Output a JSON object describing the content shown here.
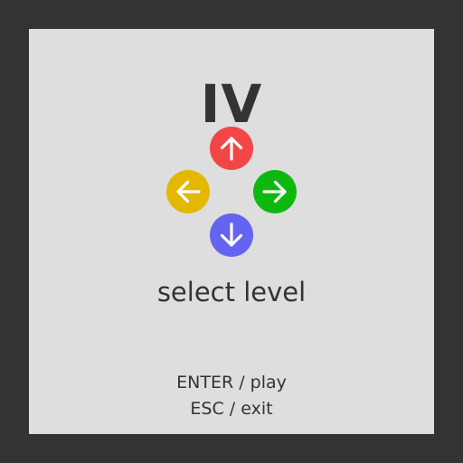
{
  "screen": {
    "level_numeral": "IV",
    "select_label": "select level"
  },
  "controls": {
    "up": {
      "icon": "arrow-up-icon",
      "color": "#f24646"
    },
    "left": {
      "icon": "arrow-left-icon",
      "color": "#e3b800"
    },
    "right": {
      "icon": "arrow-right-icon",
      "color": "#0fb80f"
    },
    "down": {
      "icon": "arrow-down-icon",
      "color": "#6464f0"
    }
  },
  "hints": {
    "play": "ENTER / play",
    "exit": "ESC / exit"
  },
  "colors": {
    "background": "#333333",
    "panel": "#dedede",
    "text": "#333333"
  }
}
